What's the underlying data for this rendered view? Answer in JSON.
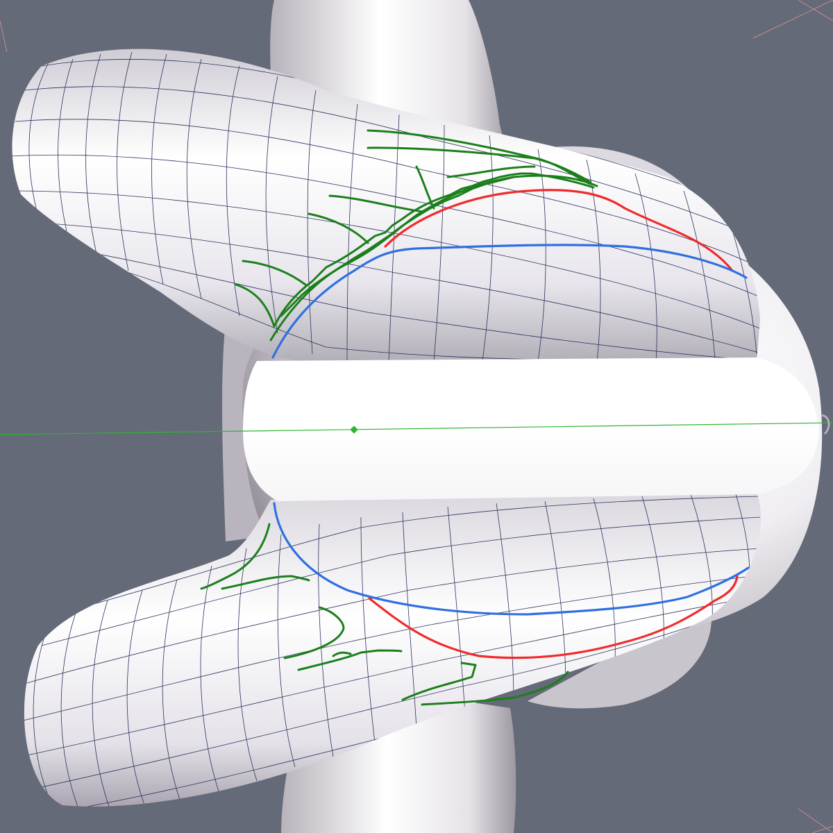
{
  "viewport": {
    "background": "#646a78",
    "mesh_fill": "#e2e0e6",
    "mesh_highlight": "#ffffff",
    "mesh_shadow": "#a49fa8",
    "wireframe": "#2b2f5c",
    "vertex": "#5a5fbf",
    "axis_line": "#2fb52f",
    "stroke_colors": {
      "red": "#f02a2a",
      "blue": "#2f6fe0",
      "green": "#1b7f1b"
    }
  },
  "scene": {
    "objects": [
      "sphere-body",
      "upper-torus-arm",
      "lower-torus-arm",
      "vertical-bulge"
    ],
    "sketch_strokes": {
      "red": 2,
      "blue": 2,
      "green": 20
    }
  }
}
